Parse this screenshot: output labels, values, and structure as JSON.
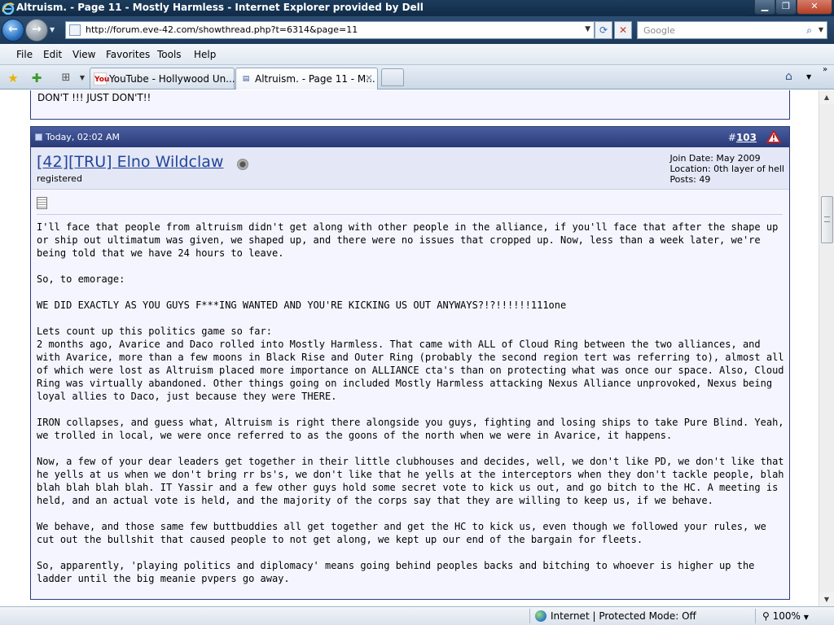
{
  "window": {
    "title": "Altruism. - Page 11 - Mostly Harmless - Internet Explorer provided by Dell",
    "minimize_icon": "minimize-icon",
    "maximize_icon": "maximize-icon",
    "close_icon": "close-icon"
  },
  "address_bar": {
    "url": "http://forum.eve-42.com/showthread.php?t=6314&page=11",
    "search_placeholder": "Google"
  },
  "menu": {
    "items": [
      "File",
      "Edit",
      "View",
      "Favorites",
      "Tools",
      "Help"
    ]
  },
  "tabs": [
    {
      "label": "YouTube - Hollywood Un...",
      "icon": "youtube-icon",
      "active": false
    },
    {
      "label": "Altruism. - Page 11 - M...",
      "icon": "forum-icon",
      "active": true
    }
  ],
  "previous_post": {
    "text": "DON'T !!! JUST DON'T!!"
  },
  "post": {
    "date": "Today, 02:02 AM",
    "number_prefix": "#",
    "number": "103",
    "username": "[42][TRU] Elno Wildclaw",
    "user_title": "registered",
    "join_date": "Join Date: May 2009",
    "location": "Location: 0th layer of hell",
    "posts": "Posts: 49",
    "paragraphs": [
      "I'll face that people from altruism didn't get along with other people in the alliance, if you'll face that after the shape up or ship out ultimatum was given, we shaped up, and there were no issues that cropped up. Now, less than a week later, we're being told that we have 24 hours to leave.",
      "So, to emorage:",
      "WE DID EXACTLY AS YOU GUYS F***ING WANTED AND YOU'RE KICKING US OUT ANYWAYS?!?!!!!!!111one",
      "Lets count up this politics game so far:\n2 months ago, Avarice and Daco rolled into Mostly Harmless. That came with ALL of Cloud Ring between the two alliances, and with Avarice, more than a few moons in Black Rise and Outer Ring (probably the second region tert was referring to), almost all of which were lost as Altruism placed more importance on ALLIANCE cta's than on protecting what was once our space. Also, Cloud Ring was virtually abandoned. Other things going on included Mostly Harmless attacking Nexus Alliance unprovoked, Nexus being loyal allies to Daco, just because they were THERE.",
      "IRON collapses, and guess what, Altruism is right there alongside you guys, fighting and losing ships to take Pure Blind. Yeah, we trolled in local, we were once referred to as the goons of the north when we were in Avarice, it happens.",
      "Now, a few of your dear leaders get together in their little clubhouses and decides, well, we don't like PD, we don't like that he yells at us when we don't bring rr bs's, we don't like that he yells at the interceptors when they don't tackle people, blah blah blah blah blah. IT Yassir and a few other guys hold some secret vote to kick us out, and go bitch to the HC. A meeting is held, and an actual vote is held, and the majority of the corps say that they are willing to keep us, if we behave.",
      "We behave, and those same few buttbuddies all get together and get the HC to kick us, even though we followed your rules, we cut out the bullshit that caused people to not get along, we kept up our end of the bargain for fleets.",
      "So, apparently, 'playing politics and diplomacy' means going behind peoples backs and bitching to whoever is higher up the ladder until the big meanie pvpers go away."
    ]
  },
  "status_bar": {
    "zone": "Internet | Protected Mode: Off",
    "zoom": "100%"
  },
  "colors": {
    "post_header": "#2a3a78",
    "username": "#22449a",
    "post_bg": "#f5f5ff",
    "userbar_bg": "#e4e8f6"
  }
}
